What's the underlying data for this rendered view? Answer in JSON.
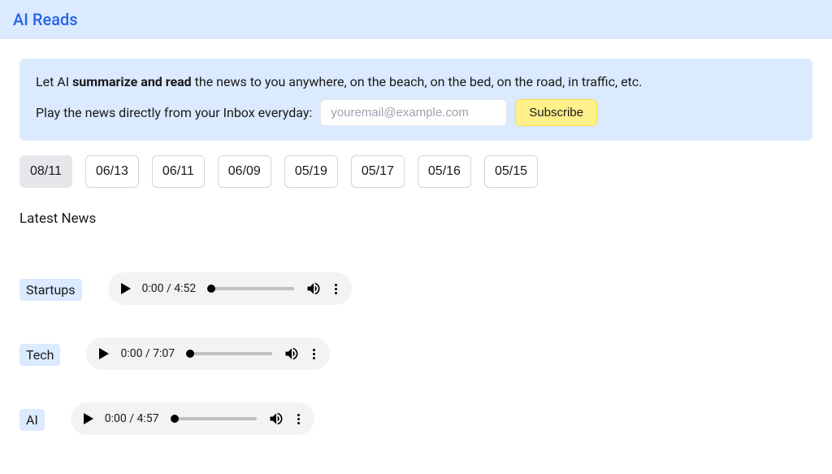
{
  "header": {
    "logo": "AI Reads"
  },
  "cta": {
    "prefix": "Let AI ",
    "bold": "summarize and read",
    "suffix": " the news to you anywhere, on the beach, on the bed, on the road, in traffic, etc.",
    "subscribe_label": "Play the news directly from your Inbox everyday:",
    "email_placeholder": "youremail@example.com",
    "subscribe_btn": "Subscribe"
  },
  "dates": [
    "08/11",
    "06/13",
    "06/11",
    "06/09",
    "05/19",
    "05/17",
    "05/16",
    "05/15"
  ],
  "active_date_index": 0,
  "section_title": "Latest News",
  "news": [
    {
      "category": "Startups",
      "current": "0:00",
      "duration": "4:52"
    },
    {
      "category": "Tech",
      "current": "0:00",
      "duration": "7:07"
    },
    {
      "category": "AI",
      "current": "0:00",
      "duration": "4:57"
    }
  ]
}
